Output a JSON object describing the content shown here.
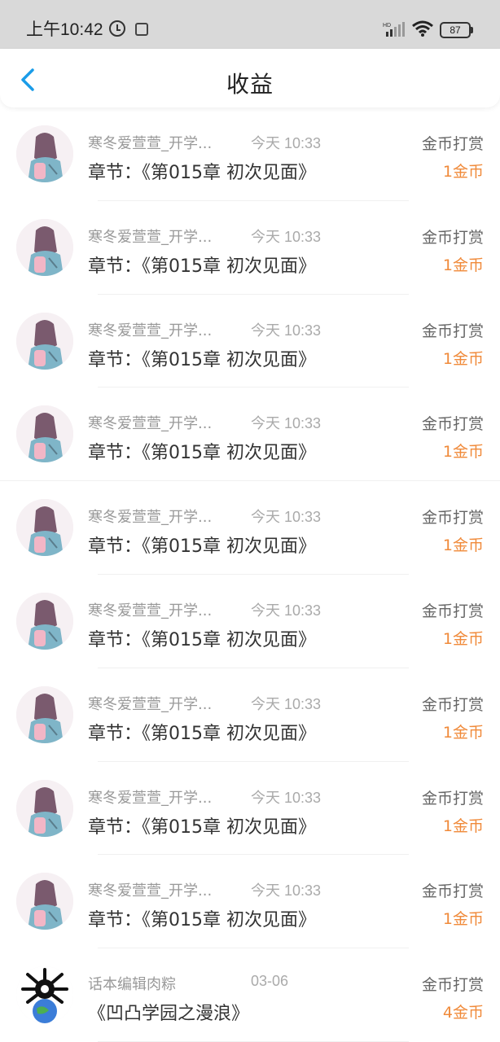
{
  "status_bar": {
    "time": "上午10:42",
    "battery": "87"
  },
  "header": {
    "title": "收益"
  },
  "colors": {
    "accent_blue": "#1a9ce8",
    "amount_orange": "#f08a3a"
  },
  "items": [
    {
      "sender": "寒冬爱萱萱_开学...",
      "time": "今天 10:33",
      "chapter": "章节：《第015章 初次见面》",
      "type": "金币打赏",
      "amount": "1金币",
      "avatar": "girl-avatar"
    },
    {
      "sender": "寒冬爱萱萱_开学...",
      "time": "今天 10:33",
      "chapter": "章节：《第015章 初次见面》",
      "type": "金币打赏",
      "amount": "1金币",
      "avatar": "girl-avatar"
    },
    {
      "sender": "寒冬爱萱萱_开学...",
      "time": "今天 10:33",
      "chapter": "章节：《第015章 初次见面》",
      "type": "金币打赏",
      "amount": "1金币",
      "avatar": "girl-avatar"
    },
    {
      "sender": "寒冬爱萱萱_开学...",
      "time": "今天 10:33",
      "chapter": "章节：《第015章 初次见面》",
      "type": "金币打赏",
      "amount": "1金币",
      "avatar": "girl-avatar"
    },
    {
      "sender": "寒冬爱萱萱_开学...",
      "time": "今天 10:33",
      "chapter": "章节：《第015章 初次见面》",
      "type": "金币打赏",
      "amount": "1金币",
      "avatar": "girl-avatar"
    },
    {
      "sender": "寒冬爱萱萱_开学...",
      "time": "今天 10:33",
      "chapter": "章节：《第015章 初次见面》",
      "type": "金币打赏",
      "amount": "1金币",
      "avatar": "girl-avatar"
    },
    {
      "sender": "寒冬爱萱萱_开学...",
      "time": "今天 10:33",
      "chapter": "章节：《第015章 初次见面》",
      "type": "金币打赏",
      "amount": "1金币",
      "avatar": "girl-avatar"
    },
    {
      "sender": "寒冬爱萱萱_开学...",
      "time": "今天 10:33",
      "chapter": "章节：《第015章 初次见面》",
      "type": "金币打赏",
      "amount": "1金币",
      "avatar": "girl-avatar"
    },
    {
      "sender": "寒冬爱萱萱_开学...",
      "time": "今天 10:33",
      "chapter": "章节：《第015章 初次见面》",
      "type": "金币打赏",
      "amount": "1金币",
      "avatar": "girl-avatar"
    },
    {
      "sender": "话本编辑肉粽",
      "time": "03-06",
      "chapter": "《凹凸学园之漫浪》",
      "type": "金币打赏",
      "amount": "4金币",
      "avatar": "editor-avatar"
    }
  ]
}
